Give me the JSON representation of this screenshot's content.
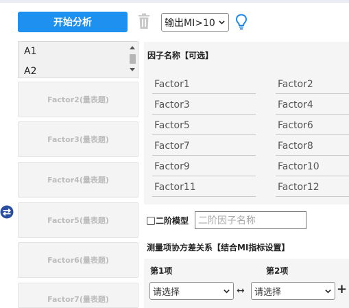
{
  "toolbar": {
    "analyze_label": "开始分析",
    "mi_select_value": "输出MI>10"
  },
  "variables": [
    "A1",
    "A2"
  ],
  "factor_boxes": [
    "Factor2(量表题)",
    "Factor3(量表题)",
    "Factor4(量表题)",
    "Factor5(量表题)",
    "Factor6(量表题)",
    "Factor7(量表题)"
  ],
  "factor_names": {
    "title": "因子名称【可选】",
    "placeholders": [
      "Factor1",
      "Factor2",
      "Factor3",
      "Factor4",
      "Factor5",
      "Factor6",
      "Factor7",
      "Factor8",
      "Factor9",
      "Factor10",
      "Factor11",
      "Factor12"
    ]
  },
  "second_order": {
    "label": "二阶模型",
    "placeholder": "二阶因子名称"
  },
  "covariance": {
    "title": "测量项协方差关系【结合MI指标设置】",
    "col1_label": "第1项",
    "col2_label": "第2项",
    "select1_value": "请选择",
    "select2_value": "请选择",
    "arrow": "↔",
    "add": "+"
  },
  "colors": {
    "primary": "#1e90f0",
    "icon_blue": "#1e88e5",
    "swap_icon": "#2a4fa0",
    "muted_icon": "#c8c8c8"
  }
}
